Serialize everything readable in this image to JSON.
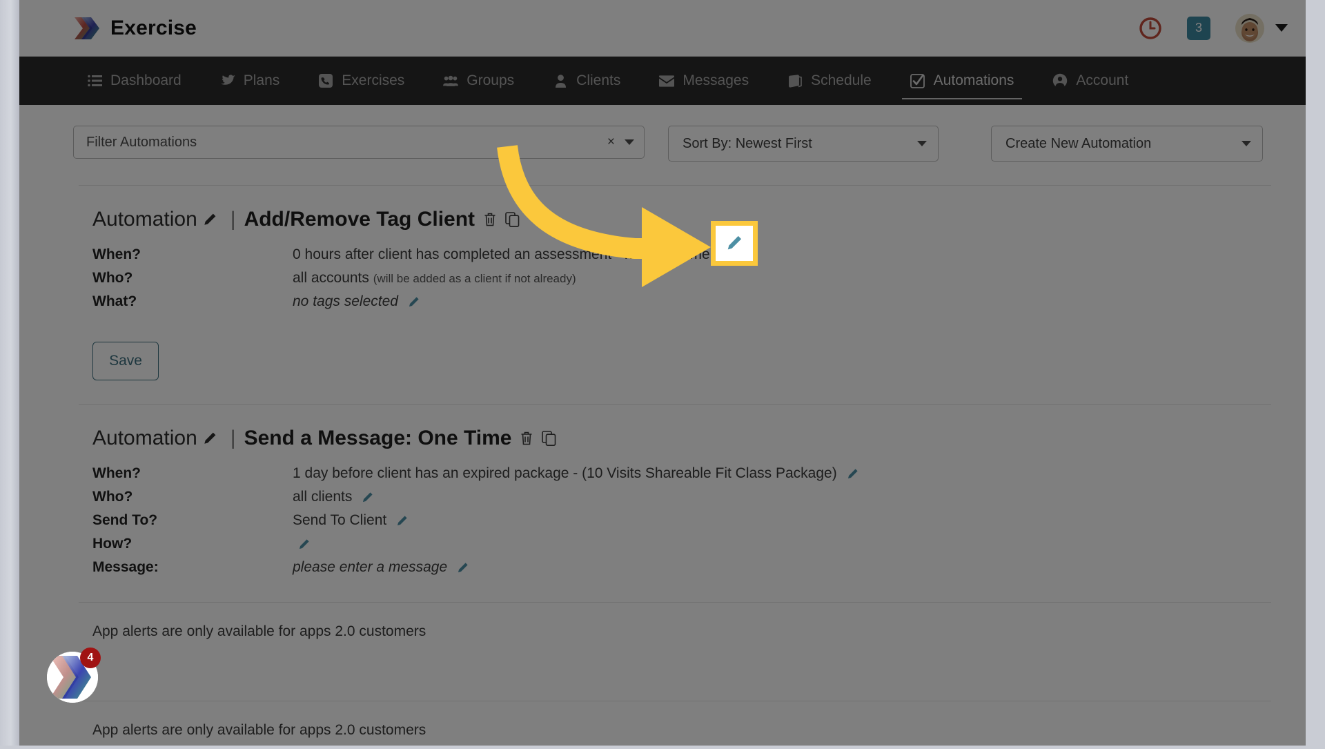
{
  "header": {
    "brand": "Exercise",
    "brand_logo_icon": "chevron-stack-logo",
    "history_icon": "clock-icon",
    "history_icon_color": "#c04a3a",
    "notification_count": "3",
    "notification_badge_color": "#3d88a0",
    "avatar_icon": "user-avatar",
    "account_menu_icon": "chevron-down-icon"
  },
  "nav": {
    "items": [
      {
        "label": "Dashboard",
        "icon": "list-icon",
        "active": false
      },
      {
        "label": "Plans",
        "icon": "bird-icon",
        "active": false
      },
      {
        "label": "Exercises",
        "icon": "phone-icon",
        "active": false
      },
      {
        "label": "Groups",
        "icon": "people-icon",
        "active": false
      },
      {
        "label": "Clients",
        "icon": "person-icon",
        "active": false
      },
      {
        "label": "Messages",
        "icon": "envelope-icon",
        "active": false
      },
      {
        "label": "Schedule",
        "icon": "book-icon",
        "active": false
      },
      {
        "label": "Automations",
        "icon": "check-square-icon",
        "active": true
      },
      {
        "label": "Account",
        "icon": "user-circle-icon",
        "active": false
      }
    ]
  },
  "toolbar": {
    "filter_placeholder": "Filter Automations",
    "filter_value": "",
    "filter_clear_icon": "close-icon",
    "filter_caret_icon": "chevron-down-icon",
    "sort_label": "Sort By: Newest First",
    "create_label": "Create New Automation",
    "caret_icon": "chevron-down-icon"
  },
  "automations": [
    {
      "prefix": "Automation",
      "separator": "|",
      "name": "Add/Remove Tag Client",
      "edit_icon": "pencil-icon",
      "delete_icon": "trash-icon",
      "duplicate_icon": "copy-icon",
      "rows": [
        {
          "key": "When?",
          "value": "0 hours after client has completed an assessment - no assessment",
          "note": "",
          "italic": false,
          "edit_icon": "pencil-icon"
        },
        {
          "key": "Who?",
          "value": "all accounts",
          "note": "(will be added as a client if not already)",
          "italic": false,
          "edit_icon": ""
        },
        {
          "key": "What?",
          "value": "no tags selected",
          "note": "",
          "italic": true,
          "edit_icon": "pencil-icon"
        }
      ],
      "save_label": "Save"
    },
    {
      "prefix": "Automation",
      "separator": "|",
      "name": "Send a Message: One Time",
      "edit_icon": "pencil-icon",
      "delete_icon": "trash-icon",
      "duplicate_icon": "copy-icon",
      "rows": [
        {
          "key": "When?",
          "value": "1 day before client has an expired package - (10 Visits Shareable Fit Class Package)",
          "note": "",
          "italic": false,
          "edit_icon": "pencil-icon"
        },
        {
          "key": "Who?",
          "value": "all clients",
          "note": "",
          "italic": false,
          "edit_icon": "pencil-icon"
        },
        {
          "key": "Send To?",
          "value": "Send To Client",
          "note": "",
          "italic": false,
          "edit_icon": "pencil-icon"
        },
        {
          "key": "How?",
          "value": "",
          "note": "",
          "italic": false,
          "edit_icon": "pencil-icon"
        },
        {
          "key": "Message:",
          "value": "please enter a message",
          "note": "",
          "italic": true,
          "edit_icon": "pencil-icon"
        }
      ],
      "save_label": ""
    }
  ],
  "notes": [
    "App alerts are only available for apps 2.0 customers",
    "App alerts are only available for apps 2.0 customers"
  ],
  "annotation": {
    "arrow_icon": "curved-arrow-icon",
    "arrow_color": "#fbc83c",
    "highlight_color": "#fbc83c",
    "highlight_target_icon": "pencil-icon"
  },
  "chat_widget": {
    "icon": "chat-logo-icon",
    "badge_count": "4",
    "badge_color": "#a01414"
  }
}
